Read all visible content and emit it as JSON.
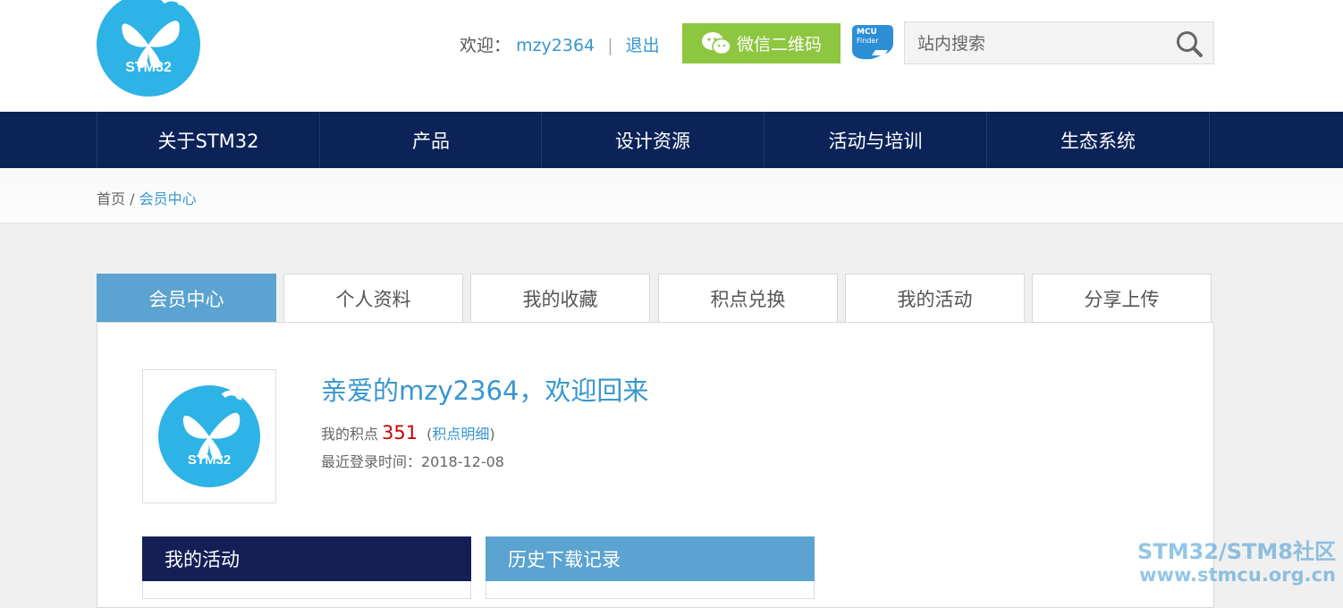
{
  "logo": {
    "text": "STM32"
  },
  "header": {
    "welcome_label": "欢迎：",
    "username": "mzy2364",
    "separator": "|",
    "logout": "退出",
    "wechat_button": "微信二维码",
    "mcu_finder_line1": "MCU",
    "mcu_finder_line2": "Finder",
    "search_placeholder": "站内搜索"
  },
  "nav": {
    "items": [
      {
        "label": "关于STM32"
      },
      {
        "label": "产品"
      },
      {
        "label": "设计资源"
      },
      {
        "label": "活动与培训"
      },
      {
        "label": "生态系统"
      }
    ]
  },
  "breadcrumb": {
    "home": "首页",
    "separator": "/",
    "current": "会员中心"
  },
  "tabs": [
    {
      "label": "会员中心",
      "active": true
    },
    {
      "label": "个人资料"
    },
    {
      "label": "我的收藏"
    },
    {
      "label": "积点兑换"
    },
    {
      "label": "我的活动"
    },
    {
      "label": "分享上传"
    }
  ],
  "profile": {
    "avatar_text": "STM32",
    "greeting": "亲爱的mzy2364，欢迎回来",
    "points_label": "我的积点",
    "points_value": "351",
    "points_detail_open": "(",
    "points_detail": "积点明细",
    "points_detail_close": ")",
    "last_login": "最近登录时间：2018-12-08"
  },
  "boxes": {
    "activities_title": "我的活动",
    "downloads_title": "历史下载记录"
  },
  "watermark": {
    "line1": "STM32/STM8社区",
    "line2": "www.stmcu.org.cn"
  },
  "colors": {
    "nav_bg": "#0b2357",
    "accent": "#3796cf",
    "tab_active": "#5ba3d0",
    "wechat": "#8dc63f",
    "points": "#cc0000",
    "logo": "#2db3e6"
  }
}
